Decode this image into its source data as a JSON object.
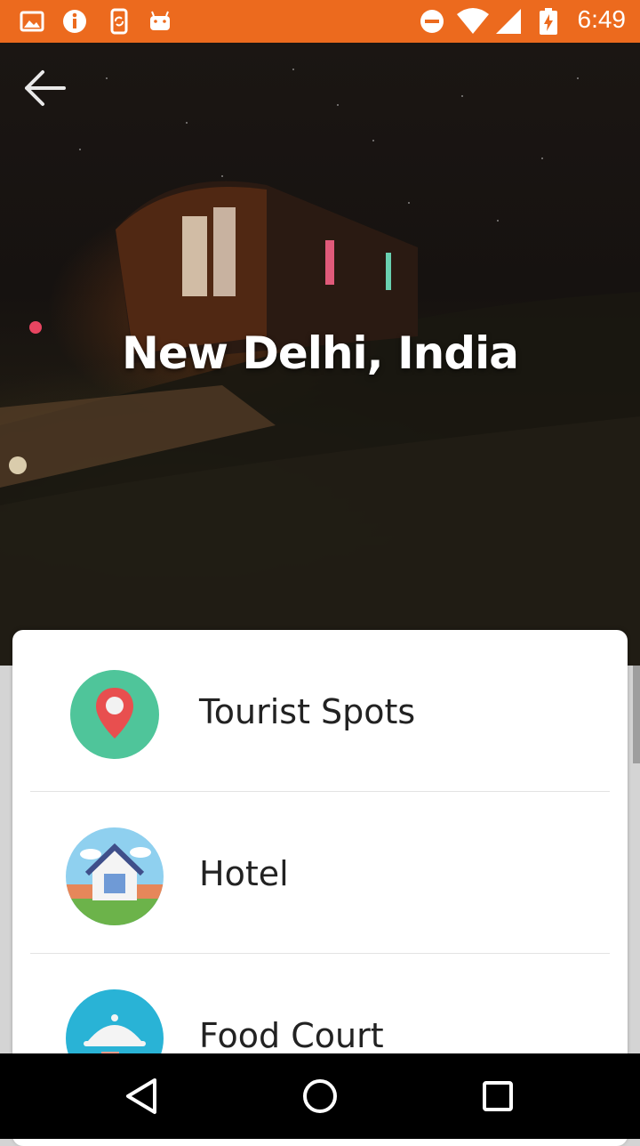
{
  "status_bar": {
    "time": "6:49",
    "left_icons": [
      "image-icon",
      "info-icon",
      "sync-phone-icon",
      "android-icon"
    ],
    "right_icons": [
      "do-not-disturb-icon",
      "wifi-icon",
      "signal-icon",
      "battery-charging-icon"
    ],
    "color": "#ec6a1e"
  },
  "header": {
    "title": "New Delhi, India",
    "back_icon": "arrow-back-icon"
  },
  "menu": {
    "items": [
      {
        "label": "Tourist Spots",
        "icon": "map-pin-icon"
      },
      {
        "label": "Hotel",
        "icon": "house-icon"
      },
      {
        "label": "Food Court",
        "icon": "food-tray-icon"
      }
    ]
  },
  "nav_bar": {
    "buttons": [
      "back-triangle-icon",
      "home-circle-icon",
      "recents-square-icon"
    ]
  }
}
